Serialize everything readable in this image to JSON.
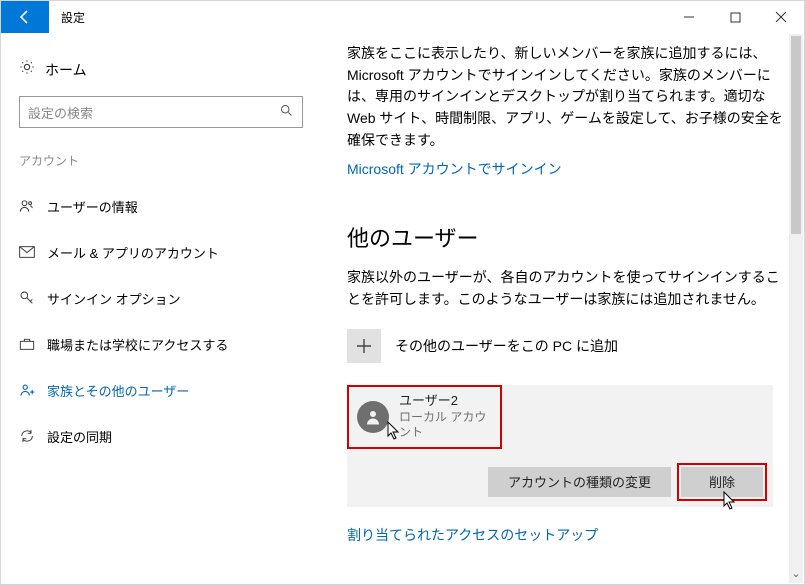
{
  "titlebar": {
    "title": "設定"
  },
  "sidebar": {
    "home": "ホーム",
    "search_placeholder": "設定の検索",
    "section": "アカウント",
    "items": [
      {
        "label": "ユーザーの情報"
      },
      {
        "label": "メール & アプリのアカウント"
      },
      {
        "label": "サインイン オプション"
      },
      {
        "label": "職場または学校にアクセスする"
      },
      {
        "label": "家族とその他のユーザー"
      },
      {
        "label": "設定の同期"
      }
    ]
  },
  "content": {
    "family_desc": "家族をここに表示したり、新しいメンバーを家族に追加するには、Microsoft アカウントでサインインしてください。家族のメンバーには、専用のサインインとデスクトップが割り当てられます。適切な Web サイト、時間制限、アプリ、ゲームを設定して、お子様の安全を確保できます。",
    "signin_link": "Microsoft アカウントでサインイン",
    "other_users_heading": "他のユーザー",
    "other_users_desc": "家族以外のユーザーが、各自のアカウントを使ってサインインすることを許可します。このようなユーザーは家族には追加されません。",
    "add_other_label": "その他のユーザーをこの PC に追加",
    "user": {
      "name": "ユーザー2",
      "type": "ローカル アカウント"
    },
    "change_type_btn": "アカウントの種類の変更",
    "delete_btn": "削除",
    "assigned_access_link": "割り当てられたアクセスのセットアップ"
  }
}
